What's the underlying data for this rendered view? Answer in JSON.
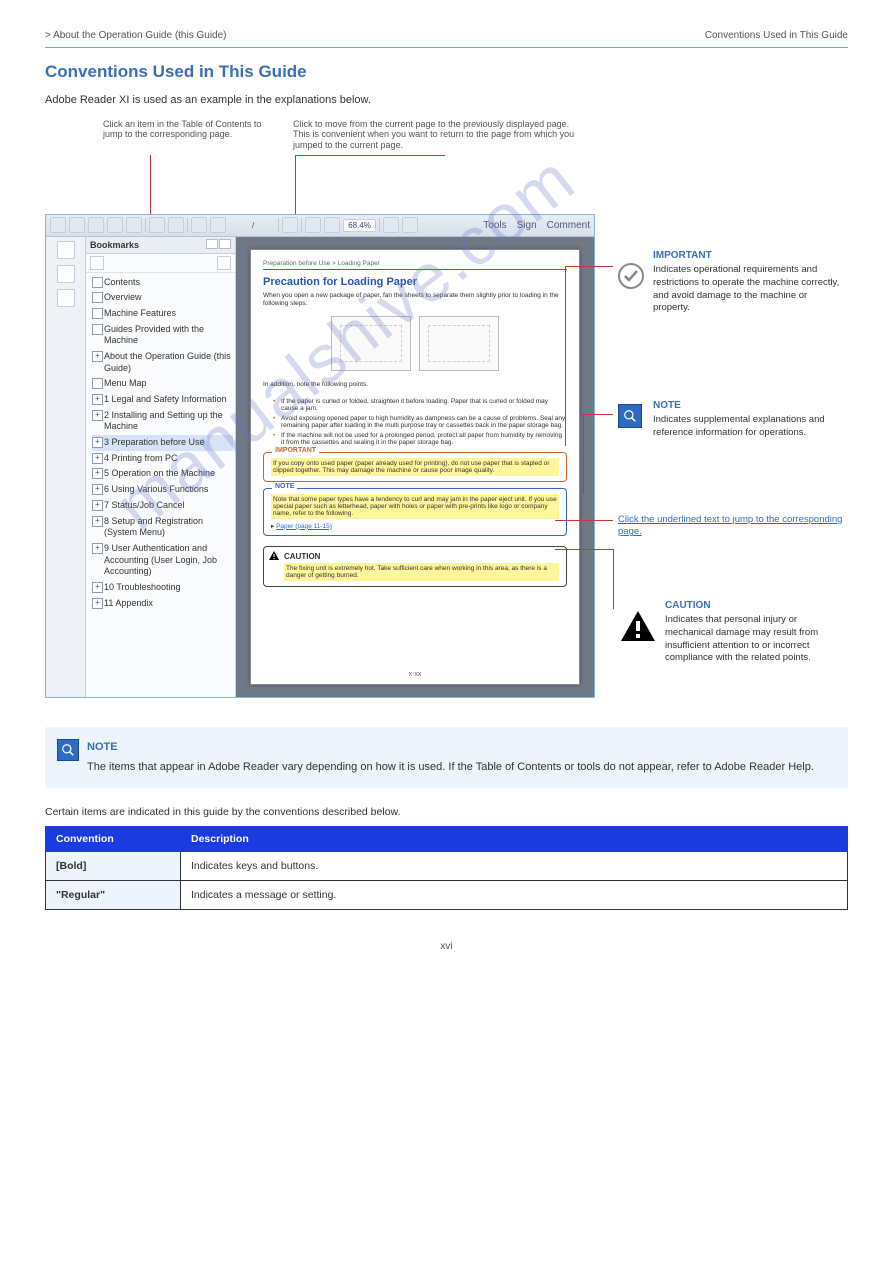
{
  "header": {
    "left": "> About the Operation Guide (this Guide)",
    "right": "Conventions Used in This Guide"
  },
  "section_title": "Conventions Used in This Guide",
  "intro": "Adobe Reader XI is used as an example in the explanations below.",
  "overlays": {
    "top_label1": "Click an item in the Table of Contents to jump to the corresponding page.",
    "top_label2": "Click to move from the current page to the previously displayed page. This is convenient when you want to return to the page from which you jumped to the current page."
  },
  "toolbar": {
    "zoom": "68.4%",
    "tools": "Tools",
    "sign": "Sign",
    "comment": "Comment"
  },
  "bookmarks": {
    "title": "Bookmarks",
    "items": [
      {
        "label": "Contents",
        "plus": false
      },
      {
        "label": "Overview",
        "plus": false
      },
      {
        "label": "Machine Features",
        "plus": false
      },
      {
        "label": "Guides Provided with the Machine",
        "plus": false
      },
      {
        "label": "About the Operation Guide (this Guide)",
        "plus": true
      },
      {
        "label": "Menu Map",
        "plus": false
      },
      {
        "label": "1 Legal and Safety Information",
        "plus": true
      },
      {
        "label": "2 Installing and Setting up the Machine",
        "plus": true
      },
      {
        "label": "3 Preparation before Use",
        "plus": true,
        "selected": true
      },
      {
        "label": "4 Printing from PC",
        "plus": true
      },
      {
        "label": "5 Operation on the Machine",
        "plus": true
      },
      {
        "label": "6 Using Various Functions",
        "plus": true
      },
      {
        "label": "7 Status/Job Cancel",
        "plus": true
      },
      {
        "label": "8 Setup and Registration (System Menu)",
        "plus": true
      },
      {
        "label": "9 User Authentication and Accounting (User Login, Job Accounting)",
        "plus": true
      },
      {
        "label": "10 Troubleshooting",
        "plus": true
      },
      {
        "label": "11 Appendix",
        "plus": true
      }
    ]
  },
  "pdf": {
    "crumb": "Preparation before Use > Loading Paper",
    "title": "Precaution for Loading Paper",
    "intro": "When you open a new package of paper, fan the sheets to separate them slightly prior to loading in the following steps.",
    "addition": "In addition, note the following points.",
    "bullets": [
      "If the paper is curled or folded, straighten it before loading. Paper that is curled or folded may cause a jam.",
      "Avoid exposing opened paper to high humidity as dampness can be a cause of problems. Seal any remaining paper after loading in the multi purpose tray or cassettes back in the paper storage bag.",
      "If the machine will not be used for a prolonged period, protect all paper from humidity by removing it from the cassettes and sealing it in the paper storage bag."
    ],
    "important_label": "IMPORTANT",
    "important_text": "If you copy onto used paper (paper already used for printing), do not use paper that is stapled or clipped together. This may damage the machine or cause poor image quality.",
    "note_label": "NOTE",
    "note_text": "Note that some paper types have a tendency to curl and may jam in the paper eject unit. If you use special paper such as letterhead, paper with holes or paper with pre-prints like logo or company name, refer to the following.",
    "note_link": "Paper (page 11-15)",
    "caution_label": "CAUTION",
    "caution_text": "The fixing unit is extremely hot. Take sufficient care when working in this area, as there is a danger of getting burned.",
    "pagenum": "x-xx"
  },
  "callouts": {
    "c1_head": "Indicates operational requirements and restrictions to operate the machine correctly, and avoid damage to the machine or property.",
    "c2_head": "Indicates supplemental explanations and reference information for operations.",
    "c3_head": "Click the underlined text to jump to the corresponding page.",
    "c4_head": "Indicates that personal injury or mechanical damage may result from insufficient attention to or incorrect compliance with the related points."
  },
  "note_block": {
    "head": "NOTE",
    "line1": "The items that appear in Adobe Reader vary depending on how it is used. If the Table of Contents or tools do not appear, refer to Adobe Reader Help."
  },
  "conv": {
    "intro": "Certain items are indicated in this guide by the conventions described below.",
    "h1": "Convention",
    "h2": "Description",
    "r1c1": "[Bold]",
    "r1c2": "Indicates keys and buttons.",
    "r2c1": "\"Regular\"",
    "r2c2": "Indicates a message or setting."
  },
  "footer": "xvi"
}
